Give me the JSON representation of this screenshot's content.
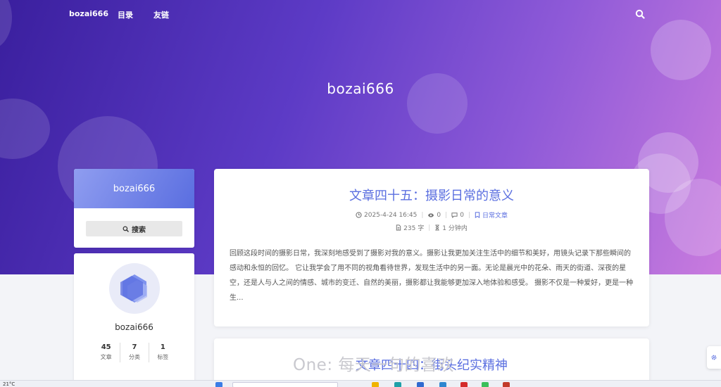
{
  "nav": {
    "brand": "bozai666",
    "toc": "目录",
    "links": "友链",
    "search_icon": "search-icon"
  },
  "hero": {
    "title": "bozai666"
  },
  "sidebar": {
    "search_card_title": "bozai666",
    "search_button": "搜索",
    "profile_name": "bozai666",
    "stats": [
      {
        "num": "45",
        "label": "文章"
      },
      {
        "num": "7",
        "label": "分类"
      },
      {
        "num": "1",
        "label": "标签"
      }
    ]
  },
  "posts": [
    {
      "title": "文章四十五：摄影日常的意义",
      "date": "2025-4-24 16:45",
      "views": "0",
      "comments": "0",
      "category": "日常文章",
      "words": "235 字",
      "read_time": "1 分钟内",
      "excerpt": "回顾这段时间的摄影日常，我深刻地感受到了摄影对我的意义。摄影让我更加关注生活中的细节和美好，用镜头记录下那些瞬间的感动和永恒的回忆。 它让我学会了用不同的视角看待世界，发现生活中的另一面。无论是晨光中的花朵、雨天的街道、深夜的星空，还是人与人之间的情感、城市的变迁、自然的美丽，摄影都让我能够更加深入地体验和感受。 摄影不仅是一种爱好，更是一种生..."
    },
    {
      "title": "文章四十四：街头纪实精神"
    }
  ],
  "hitokoto": "One: 每天一句的喜欢",
  "taskbar": {
    "temperature": "21°C"
  },
  "colors": {
    "accent": "#5b6fe0",
    "hero_start": "#3a1f9e",
    "hero_end": "#c97bde"
  }
}
